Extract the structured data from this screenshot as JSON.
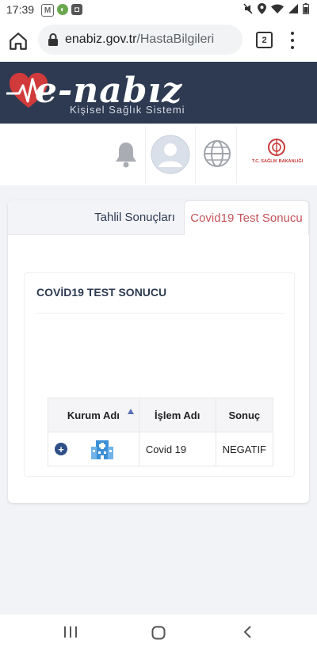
{
  "status_bar": {
    "time": "17:39",
    "left_icons": [
      "gmail-icon",
      "app-icon",
      "box-icon"
    ],
    "right_icons": [
      "mute-icon",
      "location-icon",
      "wifi-icon",
      "signal-icon",
      "battery-icon"
    ]
  },
  "browser": {
    "url_host": "enabiz.gov.tr",
    "url_path": "/HastaBilgileri",
    "tab_count": "2"
  },
  "header": {
    "brand": "e-nabız",
    "subtitle": "Kişisel Sağlık Sistemi",
    "ministry_label": "T.C. SAĞLIK BAKANLIĞI"
  },
  "tabs": [
    {
      "label": "Tahlil Sonuçları",
      "active": false
    },
    {
      "label": "Covid19 Test Sonucu",
      "active": true
    }
  ],
  "panel": {
    "title": "COVİD19 TEST SONUCU",
    "columns": [
      "Kurum Adı",
      "İşlem Adı",
      "Sonuç"
    ],
    "rows": [
      {
        "kurum_icon": "hospital-icon",
        "islem": "Covid 19",
        "sonuc": "NEGATIF"
      }
    ]
  },
  "colors": {
    "banner": "#2d3a52",
    "active_tab_text": "#c5545a",
    "accent_blue": "#2f4f88"
  }
}
